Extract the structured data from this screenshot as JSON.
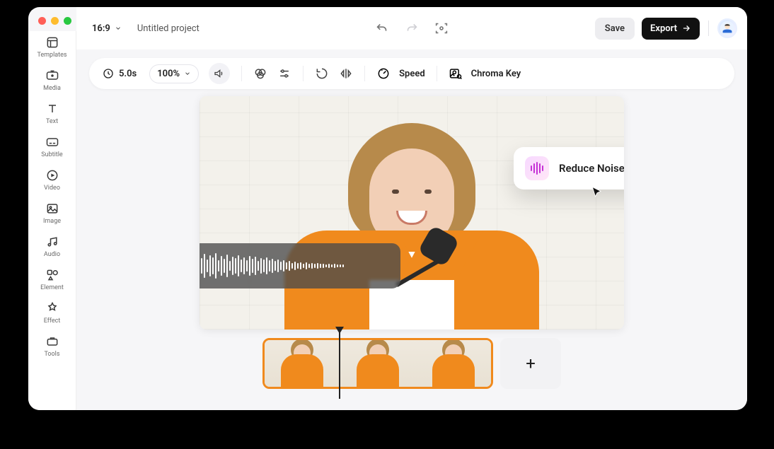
{
  "sidebar": {
    "items": [
      {
        "label": "Templates",
        "icon": "templates-icon"
      },
      {
        "label": "Media",
        "icon": "media-icon"
      },
      {
        "label": "Text",
        "icon": "text-icon"
      },
      {
        "label": "Subtitle",
        "icon": "subtitle-icon"
      },
      {
        "label": "Video",
        "icon": "video-icon"
      },
      {
        "label": "Image",
        "icon": "image-icon"
      },
      {
        "label": "Audio",
        "icon": "audio-icon"
      },
      {
        "label": "Element",
        "icon": "element-icon"
      },
      {
        "label": "Effect",
        "icon": "effect-icon"
      },
      {
        "label": "Tools",
        "icon": "tools-icon"
      }
    ]
  },
  "header": {
    "aspect_ratio": "16:9",
    "project_title": "Untitled project",
    "save_label": "Save",
    "export_label": "Export"
  },
  "toolbar": {
    "duration": "5.0s",
    "zoom": "100%",
    "speed_label": "Speed",
    "chroma_label": "Chroma Key"
  },
  "popup": {
    "label": "Reduce Noise"
  },
  "timeline": {
    "add_label": "+"
  }
}
